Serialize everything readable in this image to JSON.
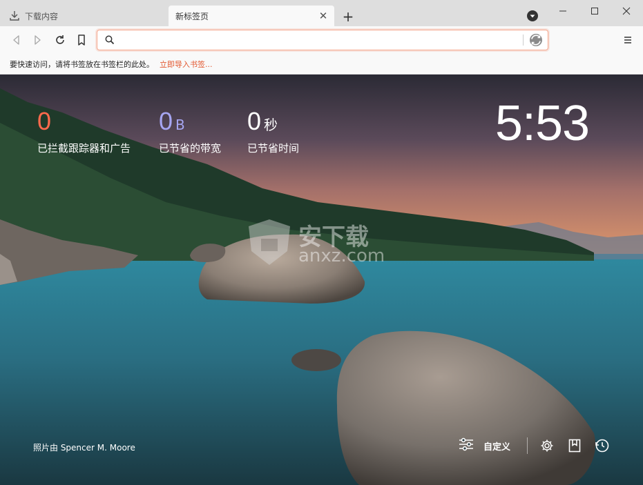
{
  "tabs": [
    {
      "label": "下载内容",
      "icon": "download-icon",
      "active": false
    },
    {
      "label": "新标签页",
      "icon": "",
      "active": true
    }
  ],
  "toolbar": {
    "search_placeholder": "",
    "search_value": ""
  },
  "bookmarks_bar": {
    "hint": "要快速访问，请将书签放在书签栏的此处。",
    "import_link": "立即导入书签..."
  },
  "stats": [
    {
      "value": "0",
      "unit": "",
      "label": "已拦截跟踪器和广告",
      "color": "#ff6a4d"
    },
    {
      "value": "0",
      "unit": "B",
      "label": "已节省的带宽",
      "color": "#a6a6f2"
    },
    {
      "value": "0",
      "unit": "秒",
      "label": "已节省时间",
      "color": "#ffffff"
    }
  ],
  "clock": "5:53",
  "photo_credit": "照片由 Spencer M. Moore",
  "customize_label": "自定义",
  "watermark": {
    "main": "安下载",
    "sub": "anxz.com"
  },
  "colors": {
    "accent": "#fb542b",
    "urlbar_border": "#f5a58a"
  }
}
